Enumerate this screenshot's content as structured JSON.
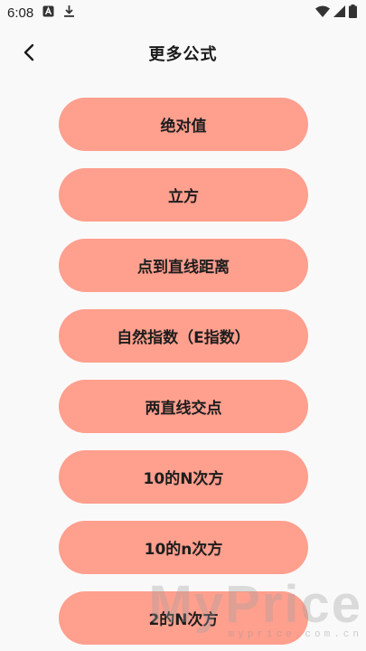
{
  "status_bar": {
    "time": "6:08",
    "icons": [
      "a-box-icon",
      "download-icon",
      "wifi-icon",
      "signal-icon",
      "battery-icon"
    ]
  },
  "header": {
    "title": "更多公式",
    "back_icon": "chevron-left-icon"
  },
  "formulas": [
    "绝对值",
    "立方",
    "点到直线距离",
    "自然指数（E指数）",
    "两直线交点",
    "10的N次方",
    "10的n次方",
    "2的N次方"
  ],
  "watermark": {
    "main": "MyPrice",
    "sub": "myprice.com.cn"
  },
  "colors": {
    "button_bg": "#ff9f8e",
    "page_bg": "#faf9f9"
  }
}
